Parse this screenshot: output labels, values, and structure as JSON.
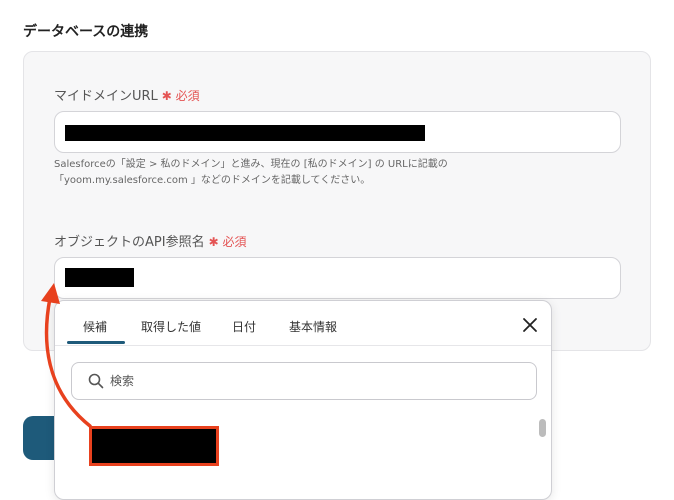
{
  "section": {
    "title": "データベースの連携"
  },
  "fields": {
    "domain": {
      "label": "マイドメインURL",
      "required_mark": "✱ 必須"
    },
    "help": {
      "line1": "Salesforceの「設定 > 私のドメイン」と進み、現在の [私のドメイン] の URLに記載の",
      "line2": "「yoom.my.salesforce.com 」などのドメインを記載してください。"
    },
    "object_api": {
      "label": "オブジェクトのAPI参照名",
      "required_mark": "✱ 必須"
    }
  },
  "popup": {
    "tabs": [
      {
        "label": "候補",
        "active": true
      },
      {
        "label": "取得した値",
        "active": false
      },
      {
        "label": "日付",
        "active": false
      },
      {
        "label": "基本情報",
        "active": false
      }
    ],
    "search_placeholder": "検索"
  },
  "colors": {
    "accent": "#1e5a7a",
    "required": "#e45454",
    "annotation": "#e8411e"
  },
  "icons": {
    "close": "close-icon",
    "search": "search-icon"
  }
}
